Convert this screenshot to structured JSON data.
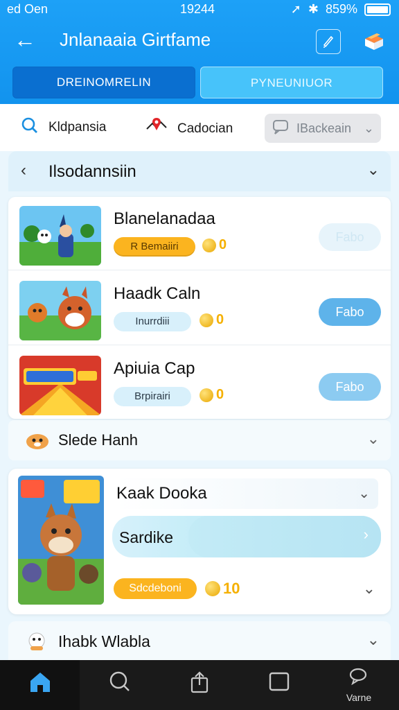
{
  "status_bar": {
    "carrier": "ed Oen",
    "time": "19244",
    "battery": "859%"
  },
  "header": {
    "title": "Jnlanaaia Girtfame"
  },
  "tabs": [
    {
      "label": "DREINOMRELIN"
    },
    {
      "label": "PYNEUNIUOR"
    }
  ],
  "filters": {
    "search_label": "Kldpansia",
    "location_label": "Cadocian",
    "dropdown_value": "IBackeain"
  },
  "section1": {
    "title": "Ilsodannsiin"
  },
  "games": [
    {
      "name": "Blanelanadaa",
      "tag": "R Bemaiiri",
      "coins": "0",
      "action": "Fabo"
    },
    {
      "name": "Haadk Caln",
      "tag": "Inurrdiii",
      "coins": "0",
      "action": "Fabo"
    },
    {
      "name": "Apiuia Cap",
      "tag": "Brpirairi",
      "coins": "0",
      "action": "Fabo"
    }
  ],
  "section2": {
    "title": "Slede Hanh"
  },
  "feature": {
    "title": "Kaak Dooka",
    "bar_label": "Sardike",
    "tag": "Sdcdeboni",
    "coins": "10"
  },
  "section3": {
    "title": "Ihabk Wlabla"
  },
  "nav": [
    {
      "label": ""
    },
    {
      "label": ""
    },
    {
      "label": ""
    },
    {
      "label": ""
    },
    {
      "label": "Varne"
    }
  ],
  "colors": {
    "header": "#1293ee",
    "accent": "#fbb41f",
    "button": "#5eb3ea"
  }
}
